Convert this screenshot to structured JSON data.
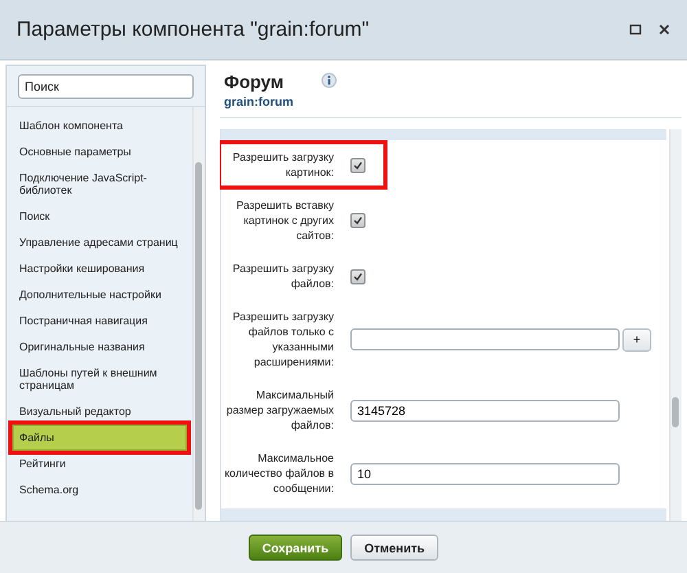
{
  "window": {
    "title": "Параметры компонента \"grain:forum\""
  },
  "search": {
    "placeholder": "Поиск"
  },
  "sidebar": {
    "items": [
      {
        "label": "Шаблон компонента",
        "selected": false,
        "highlighted": false
      },
      {
        "label": "Основные параметры",
        "selected": false,
        "highlighted": false
      },
      {
        "label": "Подключение JavaScript-библиотек",
        "selected": false,
        "highlighted": false
      },
      {
        "label": "Поиск",
        "selected": false,
        "highlighted": false
      },
      {
        "label": "Управление адресами страниц",
        "selected": false,
        "highlighted": false
      },
      {
        "label": "Настройки кеширования",
        "selected": false,
        "highlighted": false
      },
      {
        "label": "Дополнительные настройки",
        "selected": false,
        "highlighted": false
      },
      {
        "label": "Постраничная навигация",
        "selected": false,
        "highlighted": false
      },
      {
        "label": "Оригинальные названия",
        "selected": false,
        "highlighted": false
      },
      {
        "label": "Шаблоны путей к внешним страницам",
        "selected": false,
        "highlighted": false
      },
      {
        "label": "Визуальный редактор",
        "selected": false,
        "highlighted": false
      },
      {
        "label": "Файлы",
        "selected": true,
        "highlighted": true
      },
      {
        "label": "Рейтинги",
        "selected": false,
        "highlighted": false
      },
      {
        "label": "Schema.org",
        "selected": false,
        "highlighted": false
      }
    ]
  },
  "component": {
    "title": "Форум",
    "code": "grain:forum"
  },
  "settings": [
    {
      "kind": "checkbox",
      "label": "Разрешить загрузку картинок:",
      "checked": true,
      "highlighted": true
    },
    {
      "kind": "checkbox",
      "label": "Разрешить вставку картинок с других сайтов:",
      "checked": true,
      "highlighted": false
    },
    {
      "kind": "checkbox",
      "label": "Разрешить загрузку файлов:",
      "checked": true,
      "highlighted": false
    },
    {
      "kind": "list",
      "label": "Разрешить загрузку файлов только с указанными расширениями:",
      "add": "+",
      "highlighted": false
    },
    {
      "kind": "text",
      "label": "Максимальный размер загружаемых файлов:",
      "value": "3145728",
      "highlighted": false
    },
    {
      "kind": "text",
      "label": "Максимальное количество файлов в сообщении:",
      "value": "10",
      "highlighted": false
    }
  ],
  "buttons": [
    {
      "label": "Сохранить",
      "kind": "primary"
    },
    {
      "label": "Отменить",
      "kind": "secondary"
    }
  ]
}
